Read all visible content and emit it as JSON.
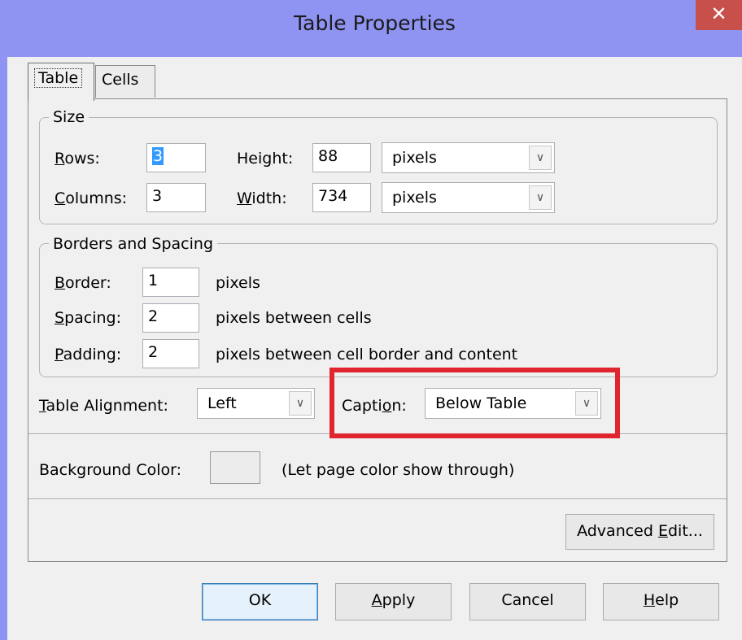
{
  "window": {
    "title": "Table Properties",
    "close_glyph": "✕"
  },
  "tabs": [
    {
      "label": "Table",
      "active": true
    },
    {
      "label": "Cells",
      "active": false
    }
  ],
  "size": {
    "group_label": "Size",
    "rows_label": "Rows:",
    "rows_value": "3",
    "columns_label": "Columns:",
    "columns_value": "3",
    "height_label": "Height:",
    "height_value": "88",
    "height_unit": "pixels",
    "width_label": "Width:",
    "width_value": "734",
    "width_unit": "pixels"
  },
  "borders": {
    "group_label": "Borders and Spacing",
    "border_label": "Border:",
    "border_value": "1",
    "border_unit": "pixels",
    "spacing_label": "Spacing:",
    "spacing_value": "2",
    "spacing_unit": "pixels between cells",
    "padding_label": "Padding:",
    "padding_value": "2",
    "padding_unit": "pixels between cell border and content"
  },
  "alignment": {
    "label": "Table Alignment:",
    "value": "Left"
  },
  "caption": {
    "label": "Caption:",
    "value": "Below Table"
  },
  "background": {
    "label": "Background Color:",
    "note": "(Let page color show through)"
  },
  "advanced_edit_label": "Advanced Edit...",
  "buttons": {
    "ok": "OK",
    "apply": "Apply",
    "cancel": "Cancel",
    "help": "Help"
  },
  "icons": {
    "dropdown": "chevron-down-icon",
    "close": "close-icon"
  },
  "colors": {
    "titlebar": "#8f93f1",
    "close_button": "#c7504b",
    "highlight_box": "#e0252f",
    "selection": "#3399ff"
  }
}
